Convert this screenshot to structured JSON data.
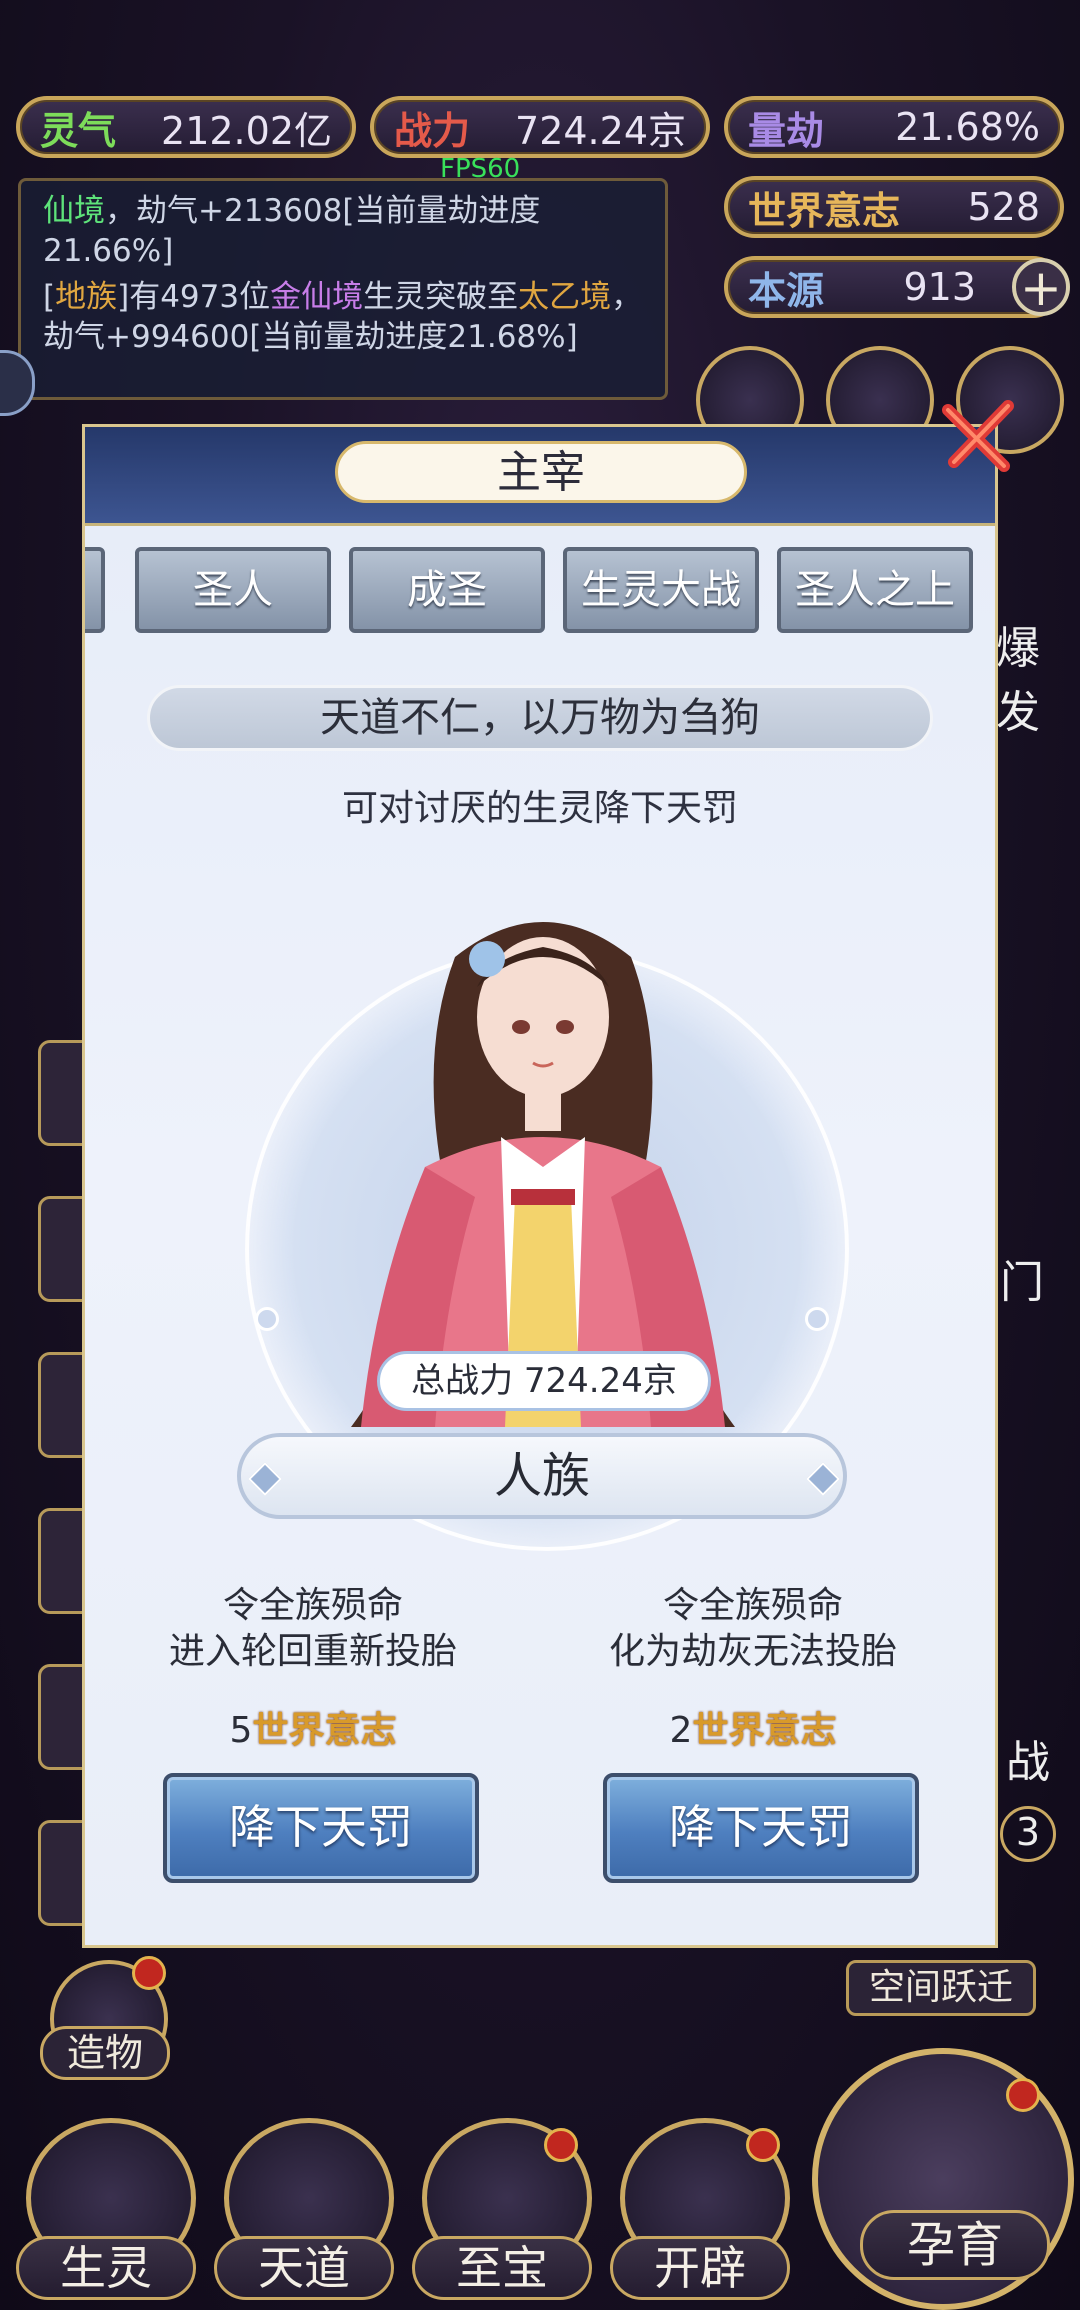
{
  "resources": {
    "lingqi": {
      "label": "灵气",
      "value": "212.02亿"
    },
    "zhanli": {
      "label": "战力",
      "value": "724.24京"
    },
    "liangjie": {
      "label": "量劫",
      "value": "21.68%"
    },
    "shijie_yizhi": {
      "label": "世界意志",
      "value": "528"
    },
    "benyuan": {
      "label": "本源",
      "value": "913"
    }
  },
  "fps": "FPS60",
  "log": {
    "line1_a": "仙境",
    "line1_b": "，劫气+213608[当前量劫进度21.66%]",
    "line2_a": "[",
    "line2_b": "地族",
    "line2_c": "]有4973位",
    "line2_d": "金仙境",
    "line2_e": "生灵突破至",
    "line2_f": "太乙境",
    "line2_g": "，劫气+994600[当前量劫进度21.68%]"
  },
  "side_labels": {
    "right_1": "爆发",
    "right_2": "门",
    "right_3": "战",
    "right_4": "3"
  },
  "dialog": {
    "title": "主宰",
    "tabs": [
      "圣人",
      "成圣",
      "生灵大战",
      "圣人之上"
    ],
    "banner": "天道不仁，以万物为刍狗",
    "subtitle": "可对讨厌的生灵降下天罚",
    "total_power": "总战力 724.24京",
    "race": "人族",
    "option_left": {
      "line1": "令全族殒命",
      "line2": "进入轮回重新投胎",
      "cost_num": "5",
      "cost_unit": "世界意志",
      "button": "降下天罚"
    },
    "option_right": {
      "line1": "令全族殒命",
      "line2": "化为劫灰无法投胎",
      "cost_num": "2",
      "cost_unit": "世界意志",
      "button": "降下天罚"
    }
  },
  "space_jump": "空间跃迁",
  "create": "造物",
  "bottom_nav": [
    "生灵",
    "天道",
    "至宝",
    "开辟",
    "孕育"
  ],
  "colors": {
    "accent_gold": "#c9a65a",
    "dialog_header": "#2f4579",
    "button_blue": "#4e7fbf",
    "badge_red": "#c1271f"
  }
}
